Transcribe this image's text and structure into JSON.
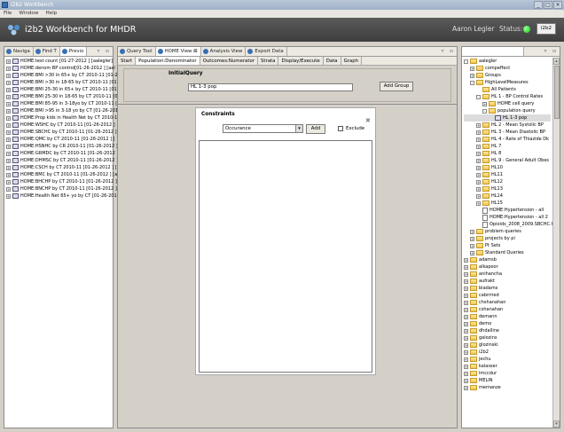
{
  "window": {
    "title": "i2b2 Workbench",
    "controls": [
      "_",
      "□",
      "×"
    ]
  },
  "menu": [
    "File",
    "Window",
    "Help"
  ],
  "header": {
    "title": "i2b2 Workbench for MHDR",
    "user": "Aaron Legler",
    "status_label": "Status:",
    "status_color": "#22cc22",
    "button": "i2b2"
  },
  "left_tabs": [
    {
      "label": "Naviga"
    },
    {
      "label": "Find T"
    },
    {
      "label": "Previo"
    }
  ],
  "left_tabs_active": "Previo",
  "previous_queries": [
    "HOME:test count [01-27-2012 ] [aalegler]",
    "HOME:denom BP control[01-26-2012 ] [aal",
    "HOME:BMI >30 in 65+ by CT 2010-11 [01-26",
    "HOME:BMI >30 in 18-65 by CT 2010-11 [01",
    "HOME:BMI 25-30 in 65+ by CT 2010-11 [01",
    "HOME:BMI 25-30 in 18-65 by CT 2010-11 [01",
    "HOME:BMI 85-95 in 3-18yo by CT 2010-11 [",
    "HOME:BMI >95 in 3-18 yo by CT [01-26-201",
    "HOME:Prop kids in Health Net by CT 2010-1",
    "HOME:WSHC by CT 2010-11 [01-26-2012 ]",
    "HOME:SBCHC by CT 2010-11 [01-26-2012 ]",
    "HOME:QMC by CT 2010-11 [01-26-2012 ] [",
    "HOME:HSNHC by CR 2010-11 [01-26-2012 ]",
    "HOME:GRMDC by CT 2010-11 [01-26-2012 ]",
    "HOME:DHMSC by CT 2010-11 [01-26-2012 ]",
    "HOME:CSCH by CT 2010-11 [01-26-2012 ] [",
    "HOME:BMC by CT 2010-11 [01-26-2012 ] [aa",
    "HOME:BHCHP by CT 2010-11 [01-26-2012 ]",
    "HOME:BNCHP by CT 2010-11 [01-26-2012 ]",
    "HOME:Health Net 65+ yo by CT [01-26-201"
  ],
  "center_tabs": [
    {
      "label": "Query Tool"
    },
    {
      "label": "HOME View"
    },
    {
      "label": "Analysis View"
    },
    {
      "label": "Export Data"
    }
  ],
  "center_tabs_active": "HOME View",
  "sub_tabs": [
    "Start",
    "Population:Denominator",
    "Outcomes:Numerator",
    "Strata",
    "Display/Execute",
    "Data",
    "Graph"
  ],
  "sub_tabs_active": "Population:Denominator",
  "initial_query": {
    "label": "InitialQuery",
    "value": "HL 1-3 pop",
    "add_group": "Add Group"
  },
  "constraints": {
    "label": "Constraints",
    "select_value": "Occurance",
    "add": "Add",
    "exclude": "Exclude",
    "close": "✖"
  },
  "right_tree": [
    {
      "t": "aalegler",
      "d": 0,
      "k": "folder",
      "x": "-"
    },
    {
      "t": "compeffect",
      "d": 1,
      "k": "folder",
      "x": "+"
    },
    {
      "t": "Groups",
      "d": 1,
      "k": "folder",
      "x": "+"
    },
    {
      "t": "HighLevelMeasures",
      "d": 1,
      "k": "folder",
      "x": "-"
    },
    {
      "t": "All Patients",
      "d": 2,
      "k": "folder",
      "x": ""
    },
    {
      "t": "HL 1 - BP Control Rates",
      "d": 2,
      "k": "folder",
      "x": "-"
    },
    {
      "t": "HOME cell query",
      "d": 3,
      "k": "folder",
      "x": "+"
    },
    {
      "t": "population query",
      "d": 3,
      "k": "folder",
      "x": "-"
    },
    {
      "t": "HL 1-3 pop",
      "d": 4,
      "k": "query",
      "x": ""
    },
    {
      "t": "HL 2 - Mean Systolic BP",
      "d": 2,
      "k": "folder",
      "x": "+"
    },
    {
      "t": "HL 3 - Mean Diastolic BP",
      "d": 2,
      "k": "folder",
      "x": "+"
    },
    {
      "t": "HL 4 - Rate of Thiazide Dk",
      "d": 2,
      "k": "folder",
      "x": "+"
    },
    {
      "t": "HL 7",
      "d": 2,
      "k": "folder",
      "x": "+"
    },
    {
      "t": "HL 8",
      "d": 2,
      "k": "folder",
      "x": "+"
    },
    {
      "t": "HL 9 - General Adult Obes",
      "d": 2,
      "k": "folder",
      "x": "+"
    },
    {
      "t": "HL10",
      "d": 2,
      "k": "folder",
      "x": "+"
    },
    {
      "t": "HL11",
      "d": 2,
      "k": "folder",
      "x": "+"
    },
    {
      "t": "HL12",
      "d": 2,
      "k": "folder",
      "x": "+"
    },
    {
      "t": "HL13",
      "d": 2,
      "k": "folder",
      "x": "+"
    },
    {
      "t": "HL14",
      "d": 2,
      "k": "folder",
      "x": "+"
    },
    {
      "t": "HL15",
      "d": 2,
      "k": "folder",
      "x": "+"
    },
    {
      "t": "HOME:Hypertension - all",
      "d": 2,
      "k": "doc",
      "x": ""
    },
    {
      "t": "HOME:Hypertension - all 2",
      "d": 2,
      "k": "doc",
      "x": ""
    },
    {
      "t": "Opioids_2008_2009.SBCHC.CS",
      "d": 2,
      "k": "doc",
      "x": ""
    },
    {
      "t": "problem queries",
      "d": 1,
      "k": "folder",
      "x": "+"
    },
    {
      "t": "projects by pi",
      "d": 1,
      "k": "folder",
      "x": "+"
    },
    {
      "t": "Pt Sets",
      "d": 1,
      "k": "folder",
      "x": "+"
    },
    {
      "t": "Standard Queries",
      "d": 1,
      "k": "folder",
      "x": "+"
    },
    {
      "t": "adamsb",
      "d": 0,
      "k": "folder",
      "x": "+"
    },
    {
      "t": "alkapoor",
      "d": 0,
      "k": "folder",
      "x": "+"
    },
    {
      "t": "anihancha",
      "d": 0,
      "k": "folder",
      "x": "+"
    },
    {
      "t": "aufrakt",
      "d": 0,
      "k": "folder",
      "x": "+"
    },
    {
      "t": "biadams",
      "d": 0,
      "k": "folder",
      "x": "+"
    },
    {
      "t": "cabrrried",
      "d": 0,
      "k": "folder",
      "x": "+"
    },
    {
      "t": "chshanahan",
      "d": 0,
      "k": "folder",
      "x": "+"
    },
    {
      "t": "cshanahan",
      "d": 0,
      "k": "folder",
      "x": "+"
    },
    {
      "t": "demann",
      "d": 0,
      "k": "folder",
      "x": "+"
    },
    {
      "t": "demo",
      "d": 0,
      "k": "folder",
      "x": "+"
    },
    {
      "t": "dhdalline",
      "d": 0,
      "k": "folder",
      "x": "+"
    },
    {
      "t": "galozins",
      "d": 0,
      "k": "folder",
      "x": "+"
    },
    {
      "t": "glozinski",
      "d": 0,
      "k": "folder",
      "x": "+"
    },
    {
      "t": "i2b2",
      "d": 0,
      "k": "folder",
      "x": "+"
    },
    {
      "t": "jechu",
      "d": 0,
      "k": "folder",
      "x": "+"
    },
    {
      "t": "kalasser",
      "d": 0,
      "k": "folder",
      "x": "+"
    },
    {
      "t": "lmccdur",
      "d": 0,
      "k": "folder",
      "x": "+"
    },
    {
      "t": "MELIN",
      "d": 0,
      "k": "folder",
      "x": "+"
    },
    {
      "t": "memanze",
      "d": 0,
      "k": "folder",
      "x": "+"
    }
  ]
}
